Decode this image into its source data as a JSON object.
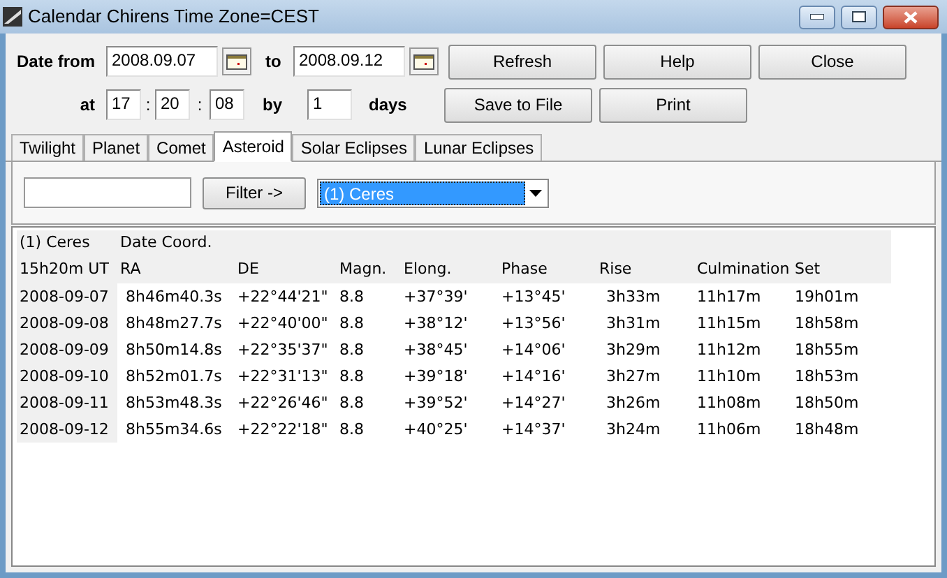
{
  "window": {
    "title": "Calendar Chirens Time Zone=CEST"
  },
  "date_row": {
    "label": "Date from",
    "from": "2008.09.07",
    "to_label": "to",
    "to": "2008.09.12"
  },
  "time_row": {
    "label": "at",
    "hour": "17",
    "sep1": ":",
    "minute": "20",
    "sep2": ":",
    "second": "08",
    "by_label": "by",
    "step": "1",
    "unit": "days"
  },
  "buttons": [
    {
      "label": "Refresh"
    },
    {
      "label": "Help"
    },
    {
      "label": "Close"
    },
    {
      "label": "Save to File"
    },
    {
      "label": "Print"
    }
  ],
  "tabs": [
    {
      "label": "Twilight",
      "selected": false
    },
    {
      "label": "Planet",
      "selected": false
    },
    {
      "label": "Comet",
      "selected": false
    },
    {
      "label": "Asteroid",
      "selected": true
    },
    {
      "label": "Solar Eclipses",
      "selected": false
    },
    {
      "label": "Lunar Eclipses",
      "selected": false
    }
  ],
  "filter": {
    "button": "Filter ->",
    "selection": "(1) Ceres"
  },
  "grid": {
    "title_row": [
      "(1) Ceres",
      "Date Coord."
    ],
    "columns": [
      "15h20m UT",
      "RA",
      "DE",
      "Magn.",
      "Elong.",
      "Phase",
      "Rise",
      "Culmination",
      "Set"
    ],
    "rows": [
      [
        "2008-09-07",
        "8h46m40.3s",
        "+22°44'21\"",
        "8.8",
        "+37°39'",
        "+13°45'",
        "3h33m",
        "11h17m",
        "19h01m"
      ],
      [
        "2008-09-08",
        "8h48m27.7s",
        "+22°40'00\"",
        "8.8",
        "+38°12'",
        "+13°56'",
        "3h31m",
        "11h15m",
        "18h58m"
      ],
      [
        "2008-09-09",
        "8h50m14.8s",
        "+22°35'37\"",
        "8.8",
        "+38°45'",
        "+14°06'",
        "3h29m",
        "11h12m",
        "18h55m"
      ],
      [
        "2008-09-10",
        "8h52m01.7s",
        "+22°31'13\"",
        "8.8",
        "+39°18'",
        "+14°16'",
        "3h27m",
        "11h10m",
        "18h53m"
      ],
      [
        "2008-09-11",
        "8h53m48.3s",
        "+22°26'46\"",
        "8.8",
        "+39°52'",
        "+14°27'",
        "3h26m",
        "11h08m",
        "18h50m"
      ],
      [
        "2008-09-12",
        "8h55m34.6s",
        "+22°22'18\"",
        "8.8",
        "+40°25'",
        "+14°37'",
        "3h24m",
        "11h06m",
        "18h48m"
      ]
    ]
  }
}
